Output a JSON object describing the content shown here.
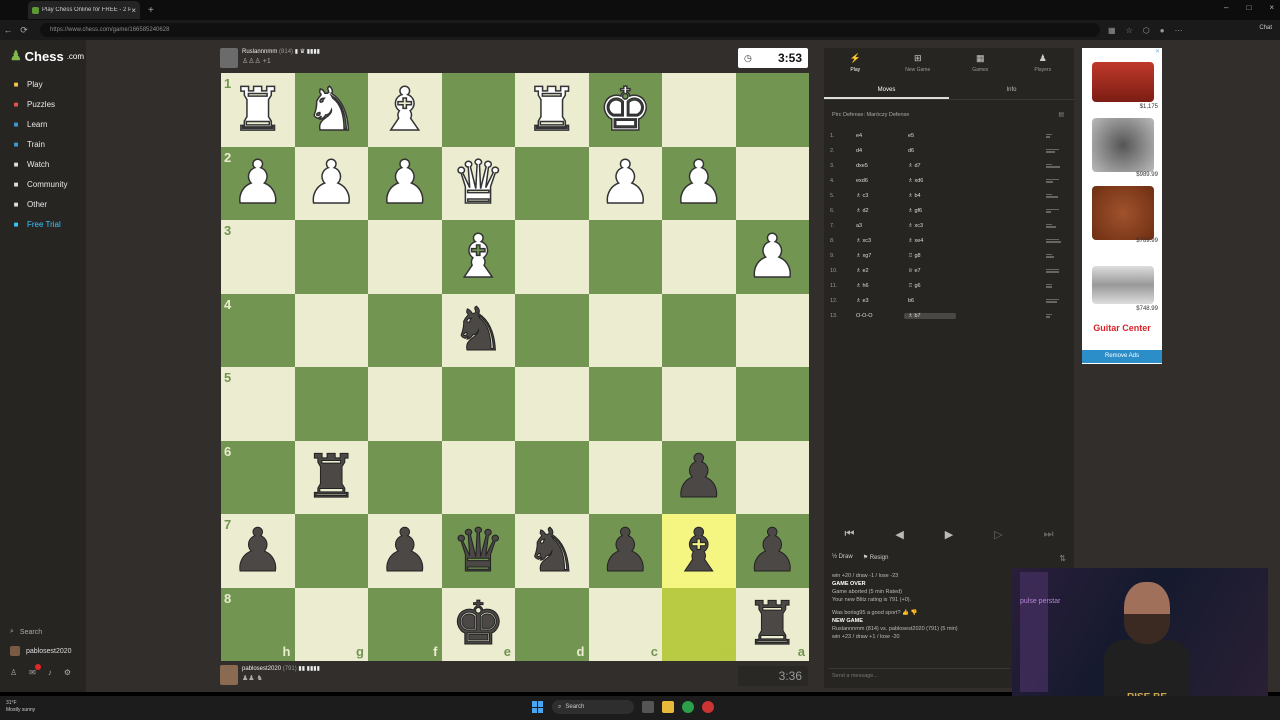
{
  "browser": {
    "tab_title": "Play Chess Online for FREE - 2 Pl...",
    "url": "https://www.chess.com/game/166585240628",
    "chat_label": "Chat"
  },
  "sidebar": {
    "logo": "Chess",
    "logo_suffix": ".com",
    "items": [
      {
        "label": "Play",
        "icon": "play-icon",
        "color": "#f2c94c"
      },
      {
        "label": "Puzzles",
        "icon": "puzzle-icon",
        "color": "#e9534b"
      },
      {
        "label": "Learn",
        "icon": "learn-icon",
        "color": "#3a9ad9"
      },
      {
        "label": "Train",
        "icon": "train-icon",
        "color": "#3a9ad9"
      },
      {
        "label": "Watch",
        "icon": "watch-icon",
        "color": "#ddd"
      },
      {
        "label": "Community",
        "icon": "community-icon",
        "color": "#ddd"
      },
      {
        "label": "Other",
        "icon": "other-icon",
        "color": "#ddd"
      },
      {
        "label": "Free Trial",
        "icon": "diamond-icon",
        "color": "#37c7ff"
      }
    ],
    "search_label": "Search",
    "username": "pablosest2020"
  },
  "top_player": {
    "name": "Ruslannnmm",
    "rating": "(814)",
    "flags": "▮ ♛ ▮▮▮▮",
    "captured": "♙♙♙ +1",
    "clock": "3:53"
  },
  "bottom_player": {
    "name": "pablosest2020",
    "rating": "(791)",
    "flags": "▮▮ ▮▮▮▮",
    "captured": "♟♟ ♞",
    "clock": "3:36"
  },
  "board": {
    "ranks": [
      "1",
      "2",
      "3",
      "4",
      "5",
      "6",
      "7",
      "8"
    ],
    "files": [
      "h",
      "g",
      "f",
      "e",
      "d",
      "c",
      "b",
      "a"
    ],
    "highlight": [
      "7-6",
      "8-6"
    ],
    "rows": [
      [
        "wR",
        "wN",
        "wB",
        "",
        "wR",
        "wK",
        "",
        ""
      ],
      [
        "wP",
        "wP",
        "wP",
        "wQ",
        "",
        "wP",
        "wP",
        ""
      ],
      [
        "",
        "",
        "",
        "wB",
        "",
        "",
        "",
        "wP"
      ],
      [
        "",
        "",
        "",
        "bN",
        "",
        "",
        "",
        ""
      ],
      [
        "",
        "",
        "",
        "",
        "",
        "",
        "",
        ""
      ],
      [
        "",
        "bR",
        "",
        "",
        "",
        "",
        "bP",
        ""
      ],
      [
        "bP",
        "",
        "bP",
        "bQ",
        "bN",
        "bP",
        "bB",
        "bP"
      ],
      [
        "",
        "",
        "",
        "bK",
        "",
        "",
        "",
        "bR"
      ]
    ]
  },
  "panel": {
    "tabs": [
      {
        "label": "Play",
        "icon": "play-lightning-icon"
      },
      {
        "label": "New Game",
        "icon": "plus-icon"
      },
      {
        "label": "Games",
        "icon": "games-icon"
      },
      {
        "label": "Players",
        "icon": "players-icon"
      }
    ],
    "subtabs": [
      "Moves",
      "Info"
    ],
    "opening": "Pirc Defense: Maróczy Defense",
    "moves": [
      {
        "n": "1.",
        "w": "e4",
        "b": "e5"
      },
      {
        "n": "2.",
        "w": "d4",
        "b": "d6"
      },
      {
        "n": "3.",
        "w": "dxe5",
        "b": "♗ d7"
      },
      {
        "n": "4.",
        "w": "exd6",
        "b": "♗ xd6"
      },
      {
        "n": "5.",
        "w": "♗ c3",
        "b": "♗ b4"
      },
      {
        "n": "6.",
        "w": "♗ d2",
        "b": "♗ gf6"
      },
      {
        "n": "7.",
        "w": "a3",
        "b": "♗ xc3"
      },
      {
        "n": "8.",
        "w": "♗ xc3",
        "b": "♗ xe4"
      },
      {
        "n": "9.",
        "w": "♗ xg7",
        "b": "♖ g8"
      },
      {
        "n": "10.",
        "w": "♗ e2",
        "b": "♕ e7"
      },
      {
        "n": "11.",
        "w": "♗ h6",
        "b": "♖ g6"
      },
      {
        "n": "12.",
        "w": "♗ e3",
        "b": "b6"
      },
      {
        "n": "13.",
        "w": "O-O-O",
        "b": "♗ b7"
      }
    ],
    "actions": {
      "draw": "Draw",
      "resign": "Resign"
    },
    "log": {
      "line1": "win +20 / draw -1 / lose -23",
      "game_over": "GAME OVER",
      "aborted": "Game aborted (5 min Rated)",
      "new_rating": "Your new Blitz rating is 791 (+0).",
      "sport_q": "Was borisg95 a good sport?",
      "new_game": "NEW GAME",
      "matchup": "Ruslannnmm (814) vs. pablosest2020 (791) (5 min)",
      "stakes": "win +23 / draw +1 / lose -20"
    },
    "send_placeholder": "Send a message..."
  },
  "ad": {
    "prices": [
      "$1,175",
      "$989.99",
      "$789.99",
      "$748.99"
    ],
    "brand": "Guitar Center",
    "remove": "Remove Ads"
  },
  "webcam": {
    "shirt_text": "RISE BE",
    "neon": "pulse\nperstar"
  },
  "taskbar": {
    "weather_temp": "31°F",
    "weather_desc": "Mostly sunny",
    "search": "Search"
  }
}
